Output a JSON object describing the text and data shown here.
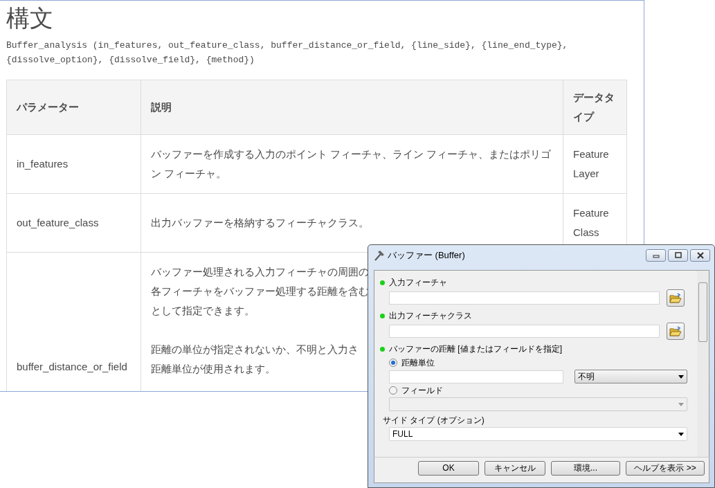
{
  "doc": {
    "title": "構文",
    "signature": "Buffer_analysis (in_features, out_feature_class, buffer_distance_or_field, {line_side}, {line_end_type}, {dissolve_option}, {dissolve_field}, {method})",
    "table": {
      "columns": [
        "パラメーター",
        "説明",
        "データタイプ"
      ],
      "rows": [
        {
          "parameter": "in_features",
          "description": [
            "バッファーを作成する入力のポイント フィーチャ、ライン フィーチャ、またはポリゴン フィーチャ。"
          ],
          "data_type": "Feature Layer"
        },
        {
          "parameter": "out_feature_class",
          "description": [
            "出力バッファーを格納するフィーチャクラス。"
          ],
          "data_type": "Feature Class"
        },
        {
          "parameter": "buffer_distance_or_field",
          "description_lines": [
            [
              "バッファー処理される入力フィーチャの周囲の",
              "各フィーチャをバッファー処理する距離を含む",
              "として指定できます。"
            ],
            [
              "距離の単位が指定されないか、不明と入力さ",
              "距離単位が使用されます。"
            ]
          ]
        }
      ]
    }
  },
  "dialog": {
    "title": "バッファー (Buffer)",
    "params": [
      {
        "kind": "input",
        "label": "入力フィーチャ",
        "required": true
      },
      {
        "kind": "input",
        "label": "出力フィーチャクラス",
        "required": true
      },
      {
        "kind": "heading",
        "label": "バッファーの距離 [値またはフィールドを指定]",
        "required": true
      },
      {
        "kind": "radio",
        "label": "距離単位",
        "selected": true,
        "unit": "不明"
      },
      {
        "kind": "radio",
        "label": "フィールド",
        "selected": false
      },
      {
        "kind": "select",
        "label": "サイド タイプ (オプション)",
        "required": false,
        "value": "FULL"
      }
    ],
    "buttons": [
      "OK",
      "キャンセル",
      "環境...",
      "ヘルプを表示 >>"
    ]
  }
}
